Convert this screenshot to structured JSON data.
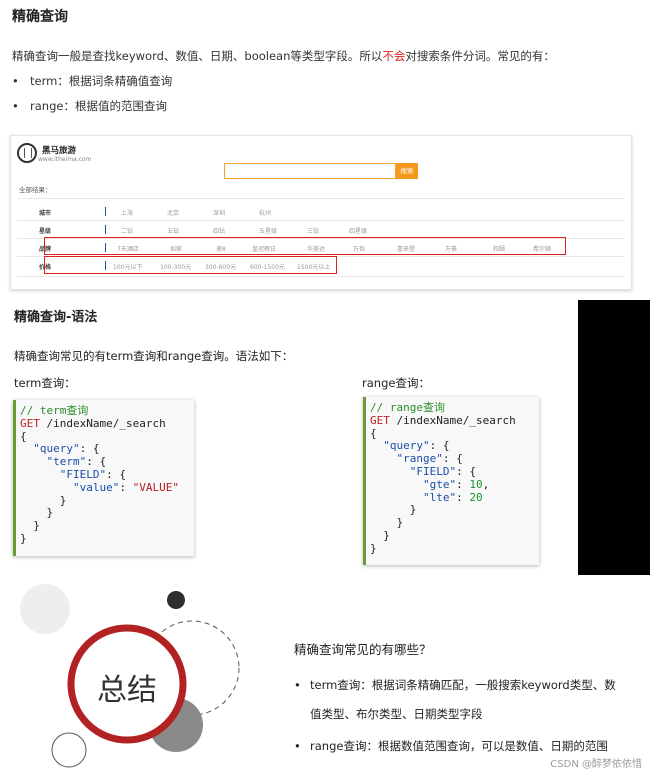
{
  "sec1": {
    "heading": "精确查询",
    "intro_a": "精确查询一般是查找keyword、数值、日期、boolean等类型字段。所以",
    "intro_red": "不会",
    "intro_b": "对搜索条件分词。常见的有：",
    "bullets": [
      "term：根据词条精确值查询",
      "range：根据值的范围查询"
    ],
    "site": {
      "brand": "黑马旅游",
      "url": "www.itheima.com",
      "search_button": "搜索",
      "all_results": "全部结果：",
      "rows": [
        {
          "label": "城市",
          "options": [
            "上海",
            "北京",
            "深圳",
            "杭州"
          ]
        },
        {
          "label": "星级",
          "options": [
            "二钻",
            "五钻",
            "四钻",
            "五星级",
            "三钻",
            "四星级"
          ]
        },
        {
          "label": "品牌",
          "options": [
            "7天酒店",
            "如家",
            "速8",
            "皇冠假日",
            "华美达",
            "万怡",
            "喜来登",
            "万豪",
            "和颐",
            "希尔顿"
          ]
        },
        {
          "label": "价格",
          "options": [
            "100元以下",
            "100-300元",
            "300-600元",
            "600-1500元",
            "1500元以上"
          ]
        }
      ]
    }
  },
  "sec2": {
    "heading": "精确查询-语法",
    "intro": "精确查询常见的有term查询和range查询。语法如下：",
    "term_label": "term查询：",
    "range_label": "range查询：",
    "term_code": {
      "comment": "// term查询",
      "method": "GET",
      "path": "/indexName/_search",
      "k_query": "\"query\"",
      "k_term": "\"term\"",
      "k_field": "\"FIELD\"",
      "k_value": "\"value\"",
      "v_value": "\"VALUE\""
    },
    "range_code": {
      "comment": "// range查询",
      "method": "GET",
      "path": "/indexName/_search",
      "k_query": "\"query\"",
      "k_range": "\"range\"",
      "k_field": "\"FIELD\"",
      "k_gte": "\"gte\"",
      "v_gte": "10",
      "k_lte": "\"lte\"",
      "v_lte": "20"
    }
  },
  "sec3": {
    "title": "总结",
    "question": "精确查询常见的有哪些？",
    "bullet1_line1": "term查询：根据词条精确匹配，一般搜索keyword类型、数",
    "bullet1_line2": "值类型、布尔类型、日期类型字段",
    "bullet2": "range查询：根据数值范围查询，可以是数值、日期的范围",
    "watermark": "CSDN @醉梦依依惜",
    "colors": {
      "ring": "#b22222",
      "dark_circle": "#2f2f2f",
      "grey_circle": "#8a8a8a",
      "light_circle": "#eeeeee"
    }
  }
}
